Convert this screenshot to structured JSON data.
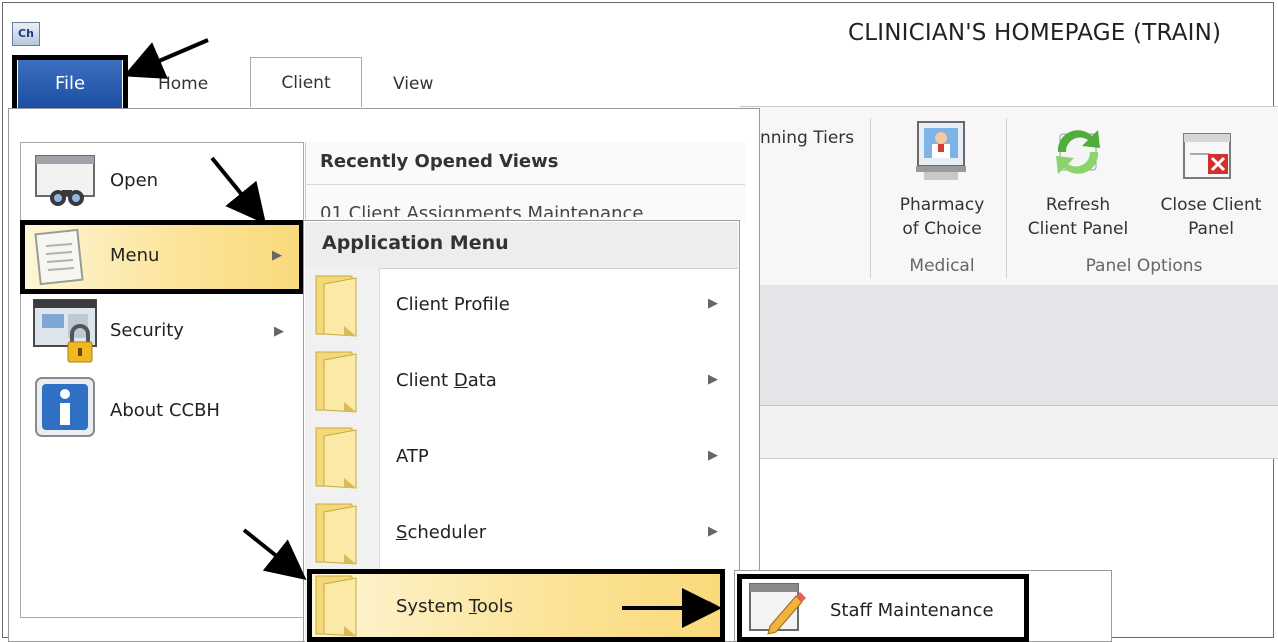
{
  "window": {
    "title": "CLINICIAN'S HOMEPAGE (TRAIN)",
    "app_icon_text": "Ch"
  },
  "tabs": {
    "file": "File",
    "home": "Home",
    "client": "Client",
    "view": "View"
  },
  "ribbon": {
    "partial_label": "nning Tiers",
    "pharmacy": {
      "line1": "Pharmacy",
      "line2": "of Choice"
    },
    "refresh": {
      "line1": "Refresh",
      "line2": "Client Panel"
    },
    "close": {
      "line1": "Close Client",
      "line2": "Panel"
    },
    "groups": {
      "medical": "Medical",
      "panel_options": "Panel Options"
    }
  },
  "file_menu": {
    "items": [
      {
        "label": "Open",
        "icon": "binoculars-window-icon"
      },
      {
        "label": "Menu",
        "icon": "document-icon",
        "has_submenu": true
      },
      {
        "label": "Security",
        "icon": "lock-window-icon",
        "has_submenu": true
      },
      {
        "label": "About CCBH",
        "icon": "info-icon"
      }
    ],
    "recent_header": "Recently Opened Views",
    "recent_items": [
      "01 Client Assignments Maintenance"
    ]
  },
  "application_menu": {
    "header": "Application Menu",
    "items": [
      {
        "pre": "Client Profile",
        "u": "",
        "post": ""
      },
      {
        "pre": "Client ",
        "u": "D",
        "post": "ata"
      },
      {
        "pre": "ATP",
        "u": "",
        "post": ""
      },
      {
        "pre": "",
        "u": "S",
        "post": "cheduler"
      },
      {
        "pre": "System ",
        "u": "T",
        "post": "ools"
      }
    ]
  },
  "system_tools_submenu": {
    "items": [
      {
        "label": "Staff Maintenance",
        "icon": "pencil-window-icon"
      }
    ]
  },
  "arrow_glyph": "▶",
  "colors": {
    "file_tab": "#1c4fa3",
    "highlight": "#fce49a",
    "annotation": "#000000"
  }
}
